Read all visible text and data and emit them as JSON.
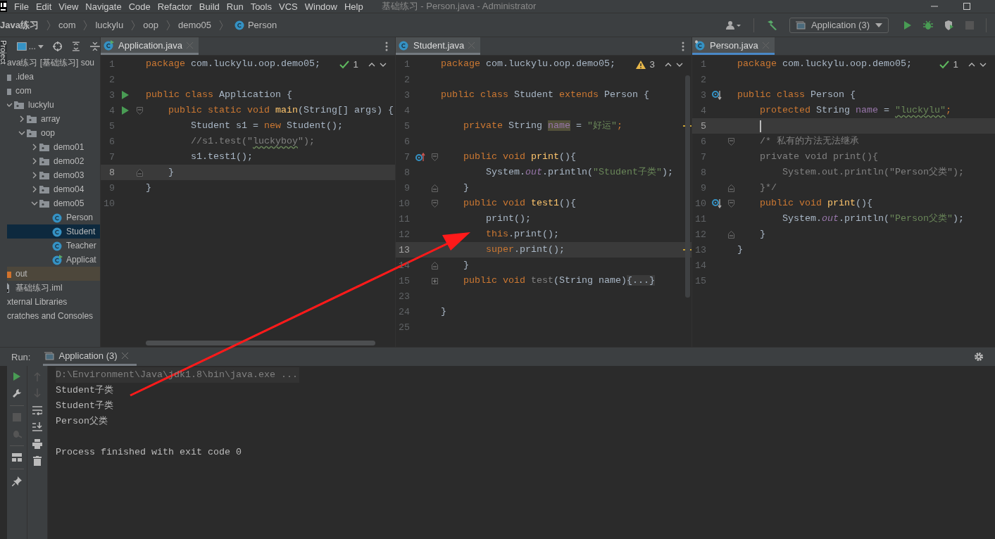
{
  "menu_bar": {
    "items": [
      "File",
      "Edit",
      "View",
      "Navigate",
      "Code",
      "Refactor",
      "Build",
      "Run",
      "Tools",
      "VCS",
      "Window",
      "Help"
    ],
    "title": "基础练习 - Person.java - Administrator"
  },
  "nav_bar": {
    "breadcrumb": [
      {
        "label": "Java练习",
        "kind": "project"
      },
      {
        "label": "com",
        "kind": "package"
      },
      {
        "label": "luckylu",
        "kind": "package"
      },
      {
        "label": "oop",
        "kind": "package"
      },
      {
        "label": "demo05",
        "kind": "package"
      },
      {
        "label": "Person",
        "kind": "class"
      }
    ],
    "run_config": "Application (3)"
  },
  "project": {
    "tool_window": "Project",
    "view": "...",
    "tree": [
      {
        "label": "ava练习 [基础练习] sou",
        "selected": false,
        "children": [
          {
            "label": ".idea",
            "kind": "folder",
            "selected": false
          },
          {
            "label": "com",
            "kind": "folder",
            "selected": false,
            "children": [
              {
                "label": "luckylu",
                "kind": "package",
                "expanded": true,
                "selected": false,
                "children": [
                  {
                    "label": "array",
                    "kind": "package",
                    "expanded": false,
                    "selected": false
                  },
                  {
                    "label": "oop",
                    "kind": "package",
                    "expanded": true,
                    "selected": false,
                    "children": [
                      {
                        "label": "demo01",
                        "kind": "package",
                        "expanded": false,
                        "selected": false
                      },
                      {
                        "label": "demo02",
                        "kind": "package",
                        "expanded": false,
                        "selected": false
                      },
                      {
                        "label": "demo03",
                        "kind": "package",
                        "expanded": false,
                        "selected": false
                      },
                      {
                        "label": "demo04",
                        "kind": "package",
                        "expanded": false,
                        "selected": false
                      },
                      {
                        "label": "demo05",
                        "kind": "package",
                        "expanded": true,
                        "selected": false,
                        "children": [
                          {
                            "label": "Person",
                            "kind": "class",
                            "selected": false
                          },
                          {
                            "label": "Student",
                            "kind": "class",
                            "selected": true
                          },
                          {
                            "label": "Teacher",
                            "kind": "class",
                            "selected": false
                          },
                          {
                            "label": "Applicat",
                            "kind": "runnable-class",
                            "selected": false
                          }
                        ]
                      }
                    ]
                  }
                ]
              }
            ]
          },
          {
            "label": "out",
            "kind": "excluded-folder",
            "selected": false
          },
          {
            "label": "基础练习.iml",
            "kind": "iml-file",
            "selected": false
          }
        ]
      },
      {
        "label": "xternal Libraries",
        "selected": false
      },
      {
        "label": "cratches and Consoles",
        "selected": false
      }
    ]
  },
  "editors": [
    {
      "tab": {
        "label": "Application.java",
        "kind": "runnable-class",
        "modified": false,
        "focused": false
      },
      "inspection": {
        "kind": "ok",
        "count": "1"
      },
      "lines": [
        {
          "n": "1",
          "current": false,
          "tokens": [
            {
              "t": "package",
              "kind": "kw"
            },
            {
              "t": " com.luckylu.oop.demo05;",
              "kind": "plain"
            }
          ]
        },
        {
          "n": "2",
          "current": false
        },
        {
          "n": "3",
          "current": false,
          "gutter_icon": {
            "kind": "run"
          },
          "tokens": [
            {
              "t": "public class",
              "kind": "kw"
            },
            {
              "t": " Application {",
              "kind": "plain"
            }
          ]
        },
        {
          "n": "4",
          "current": false,
          "gutter_icon": {
            "kind": "run"
          },
          "fold_marker": {
            "kind": "start"
          },
          "tokens": [
            {
              "t": "    public static void ",
              "kind": "kw"
            },
            {
              "t": "main",
              "kind": "fn"
            },
            {
              "t": "(String[] args) {",
              "kind": "plain"
            }
          ]
        },
        {
          "n": "5",
          "current": false,
          "tokens": [
            {
              "t": "        Student s1 = ",
              "kind": "plain"
            },
            {
              "t": "new",
              "kind": "kw"
            },
            {
              "t": " Student();",
              "kind": "plain"
            }
          ]
        },
        {
          "n": "6",
          "current": false,
          "tokens": [
            {
              "t": "        //s1.test(\"",
              "kind": "comment"
            },
            {
              "t": "luckyboy",
              "kind": "typo-comment"
            },
            {
              "t": "\");",
              "kind": "comment"
            }
          ]
        },
        {
          "n": "7",
          "current": false,
          "tokens": [
            {
              "t": "        s1.test1();",
              "kind": "plain"
            }
          ]
        },
        {
          "n": "8",
          "current": true,
          "fold_marker": {
            "kind": "end"
          },
          "tokens": [
            {
              "t": "    }",
              "kind": "plain"
            }
          ]
        },
        {
          "n": "9",
          "current": false,
          "tokens": [
            {
              "t": "}",
              "kind": "plain"
            }
          ]
        },
        {
          "n": "10",
          "current": false
        }
      ]
    },
    {
      "tab": {
        "label": "Student.java",
        "kind": "class",
        "modified": false,
        "focused": false
      },
      "inspection": {
        "kind": "warning",
        "count": "3"
      },
      "lines": [
        {
          "n": "1",
          "current": false,
          "tokens": [
            {
              "t": "package",
              "kind": "kw"
            },
            {
              "t": " com.luckylu.oop.demo05;",
              "kind": "plain"
            }
          ]
        },
        {
          "n": "2",
          "current": false
        },
        {
          "n": "3",
          "current": false,
          "tokens": [
            {
              "t": "public class ",
              "kind": "kw"
            },
            {
              "t": "Student ",
              "kind": "plain"
            },
            {
              "t": "extends ",
              "kind": "kw"
            },
            {
              "t": "Person {",
              "kind": "plain"
            }
          ]
        },
        {
          "n": "4",
          "current": false
        },
        {
          "n": "5",
          "current": false,
          "warning": true,
          "tokens": [
            {
              "t": "    private ",
              "kind": "kw"
            },
            {
              "t": "String ",
              "kind": "plain"
            },
            {
              "t": "name",
              "kind": "field-hl"
            },
            {
              "t": " = ",
              "kind": "plain"
            },
            {
              "t": "\"好运\"",
              "kind": "str"
            },
            {
              "t": ";",
              "kind": "kw"
            }
          ]
        },
        {
          "n": "6",
          "current": false
        },
        {
          "n": "7",
          "current": false,
          "gutter_icon": {
            "kind": "overrides"
          },
          "fold_marker": {
            "kind": "start"
          },
          "tokens": [
            {
              "t": "    public void ",
              "kind": "kw"
            },
            {
              "t": "print",
              "kind": "fn"
            },
            {
              "t": "(){",
              "kind": "plain"
            }
          ]
        },
        {
          "n": "8",
          "current": false,
          "tokens": [
            {
              "t": "        System.",
              "kind": "plain"
            },
            {
              "t": "out",
              "kind": "static"
            },
            {
              "t": ".println(",
              "kind": "plain"
            },
            {
              "t": "\"Student子类\"",
              "kind": "str"
            },
            {
              "t": ");",
              "kind": "plain"
            }
          ]
        },
        {
          "n": "9",
          "current": false,
          "fold_marker": {
            "kind": "end"
          },
          "tokens": [
            {
              "t": "    }",
              "kind": "plain"
            }
          ]
        },
        {
          "n": "10",
          "current": false,
          "fold_marker": {
            "kind": "start"
          },
          "tokens": [
            {
              "t": "    public void ",
              "kind": "kw"
            },
            {
              "t": "test1",
              "kind": "fn"
            },
            {
              "t": "(){",
              "kind": "plain"
            }
          ]
        },
        {
          "n": "11",
          "current": false,
          "tokens": [
            {
              "t": "        print();",
              "kind": "plain"
            }
          ]
        },
        {
          "n": "12",
          "current": false,
          "tokens": [
            {
              "t": "        this",
              "kind": "kw"
            },
            {
              "t": ".print();",
              "kind": "plain"
            }
          ]
        },
        {
          "n": "13",
          "current": true,
          "warning": true,
          "tokens": [
            {
              "t": "        super",
              "kind": "kw"
            },
            {
              "t": ".print();",
              "kind": "plain"
            }
          ]
        },
        {
          "n": "14",
          "current": false,
          "fold_marker": {
            "kind": "end"
          },
          "tokens": [
            {
              "t": "    }",
              "kind": "plain"
            }
          ]
        },
        {
          "n": "15",
          "current": false,
          "fold_marker": {
            "kind": "collapsed"
          },
          "tokens": [
            {
              "t": "    public void ",
              "kind": "kw"
            },
            {
              "t": "test",
              "kind": "unused"
            },
            {
              "t": "(String name)",
              "kind": "plain"
            },
            {
              "t": "{...}",
              "kind": "folded"
            }
          ]
        },
        {
          "n": "23",
          "current": false
        },
        {
          "n": "24",
          "current": false,
          "tokens": [
            {
              "t": "}",
              "kind": "plain"
            }
          ]
        },
        {
          "n": "25",
          "current": false
        }
      ]
    },
    {
      "tab": {
        "label": "Person.java",
        "kind": "class",
        "modified": true,
        "focused": true
      },
      "inspection": {
        "kind": "ok",
        "count": "1"
      },
      "lines": [
        {
          "n": "1",
          "current": false,
          "tokens": [
            {
              "t": "package",
              "kind": "kw"
            },
            {
              "t": " com.luckylu.oop.demo05;",
              "kind": "plain"
            }
          ]
        },
        {
          "n": "2",
          "current": false
        },
        {
          "n": "3",
          "current": false,
          "gutter_icon": {
            "kind": "subclassed"
          },
          "tokens": [
            {
              "t": "public class ",
              "kind": "kw"
            },
            {
              "t": "Person {",
              "kind": "plain"
            }
          ]
        },
        {
          "n": "4",
          "current": false,
          "tokens": [
            {
              "t": "    protected ",
              "kind": "kw"
            },
            {
              "t": "String ",
              "kind": "plain"
            },
            {
              "t": "name",
              "kind": "field"
            },
            {
              "t": " = ",
              "kind": "plain"
            },
            {
              "t": "\"luckylu\"",
              "kind": "typo-str"
            },
            {
              "t": ";",
              "kind": "kw"
            }
          ]
        },
        {
          "n": "5",
          "current": true
        },
        {
          "n": "6",
          "current": false,
          "fold_marker": {
            "kind": "start"
          },
          "tokens": [
            {
              "t": "    /* 私有的方法无法继承",
              "kind": "comment"
            }
          ]
        },
        {
          "n": "7",
          "current": false,
          "tokens": [
            {
              "t": "    private void print(){",
              "kind": "comment"
            }
          ]
        },
        {
          "n": "8",
          "current": false,
          "tokens": [
            {
              "t": "        System.out.println(\"Person父类\");",
              "kind": "comment"
            }
          ]
        },
        {
          "n": "9",
          "current": false,
          "fold_marker": {
            "kind": "end"
          },
          "tokens": [
            {
              "t": "    }*/",
              "kind": "comment"
            }
          ]
        },
        {
          "n": "10",
          "current": false,
          "gutter_icon": {
            "kind": "subclassed"
          },
          "fold_marker": {
            "kind": "start"
          },
          "tokens": [
            {
              "t": "    public void ",
              "kind": "kw"
            },
            {
              "t": "print",
              "kind": "fn"
            },
            {
              "t": "(){",
              "kind": "plain"
            }
          ]
        },
        {
          "n": "11",
          "current": false,
          "tokens": [
            {
              "t": "        System.",
              "kind": "plain"
            },
            {
              "t": "out",
              "kind": "static"
            },
            {
              "t": ".println(",
              "kind": "plain"
            },
            {
              "t": "\"Person父类\"",
              "kind": "str"
            },
            {
              "t": ");",
              "kind": "plain"
            }
          ]
        },
        {
          "n": "12",
          "current": false,
          "fold_marker": {
            "kind": "end"
          },
          "tokens": [
            {
              "t": "    }",
              "kind": "plain"
            }
          ]
        },
        {
          "n": "13",
          "current": false,
          "tokens": [
            {
              "t": "}",
              "kind": "plain"
            }
          ]
        },
        {
          "n": "14",
          "current": false
        },
        {
          "n": "15",
          "current": false
        }
      ]
    }
  ],
  "run": {
    "label": "Run:",
    "tab": "Application (3)",
    "console": [
      {
        "kind": "command",
        "text": "D:\\Environment\\Java\\jdk1.8\\bin\\java.exe ..."
      },
      {
        "kind": "output",
        "text": "Student子类"
      },
      {
        "kind": "output",
        "text": "Student子类"
      },
      {
        "kind": "output",
        "text": "Person父类"
      },
      {
        "kind": "system",
        "text": "Process finished with exit code 0"
      }
    ]
  }
}
